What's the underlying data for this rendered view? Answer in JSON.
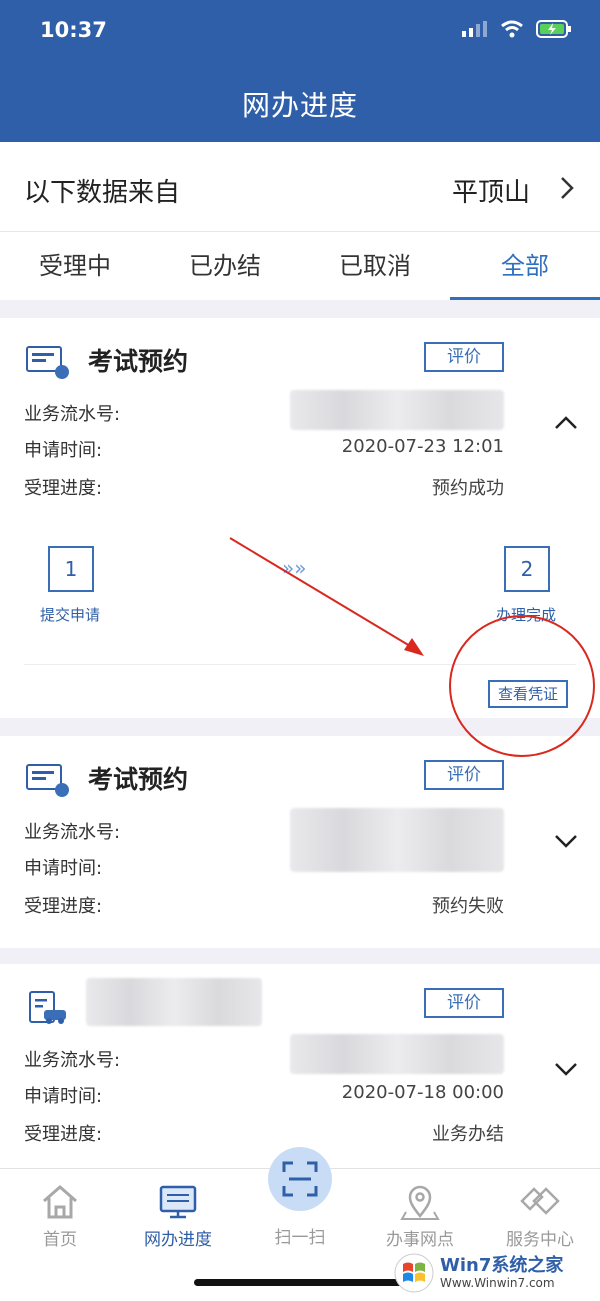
{
  "status_bar": {
    "time": "10:37"
  },
  "header": {
    "title": "网办进度"
  },
  "source": {
    "label": "以下数据来自",
    "city": "平顶山"
  },
  "tabs": [
    {
      "label": "受理中",
      "active": false
    },
    {
      "label": "已办结",
      "active": false
    },
    {
      "label": "已取消",
      "active": false
    },
    {
      "label": "全部",
      "active": true
    }
  ],
  "field_labels": {
    "serial": "业务流水号:",
    "apply_time": "申请时间:",
    "progress": "受理进度:"
  },
  "cards": [
    {
      "title": "考试预约",
      "eval_label": "评价",
      "apply_time": "2020-07-23 12:01",
      "progress": "预约成功",
      "expanded": true,
      "steps": [
        {
          "num": "1",
          "label": "提交申请"
        },
        {
          "num": "2",
          "label": "办理完成"
        }
      ],
      "voucher_label": "查看凭证"
    },
    {
      "title": "考试预约",
      "eval_label": "评价",
      "progress": "预约失败",
      "expanded": false
    },
    {
      "eval_label": "评价",
      "apply_time": "2020-07-18 00:00",
      "progress": "业务办结",
      "expanded": false
    }
  ],
  "tabbar": [
    {
      "label": "首页",
      "icon": "home-icon",
      "active": false
    },
    {
      "label": "网办进度",
      "icon": "monitor-icon",
      "active": true
    },
    {
      "label": "扫一扫",
      "icon": "scan-icon",
      "active": false
    },
    {
      "label": "办事网点",
      "icon": "location-pin-icon",
      "active": false
    },
    {
      "label": "服务中心",
      "icon": "handshake-icon",
      "active": false
    }
  ],
  "watermark": {
    "brand": "Win7系统之家",
    "url": "Www.Winwin7.com"
  },
  "colors": {
    "primary": "#2f5fa8",
    "accent": "#3a6fb8",
    "annotation": "#d9281e"
  }
}
